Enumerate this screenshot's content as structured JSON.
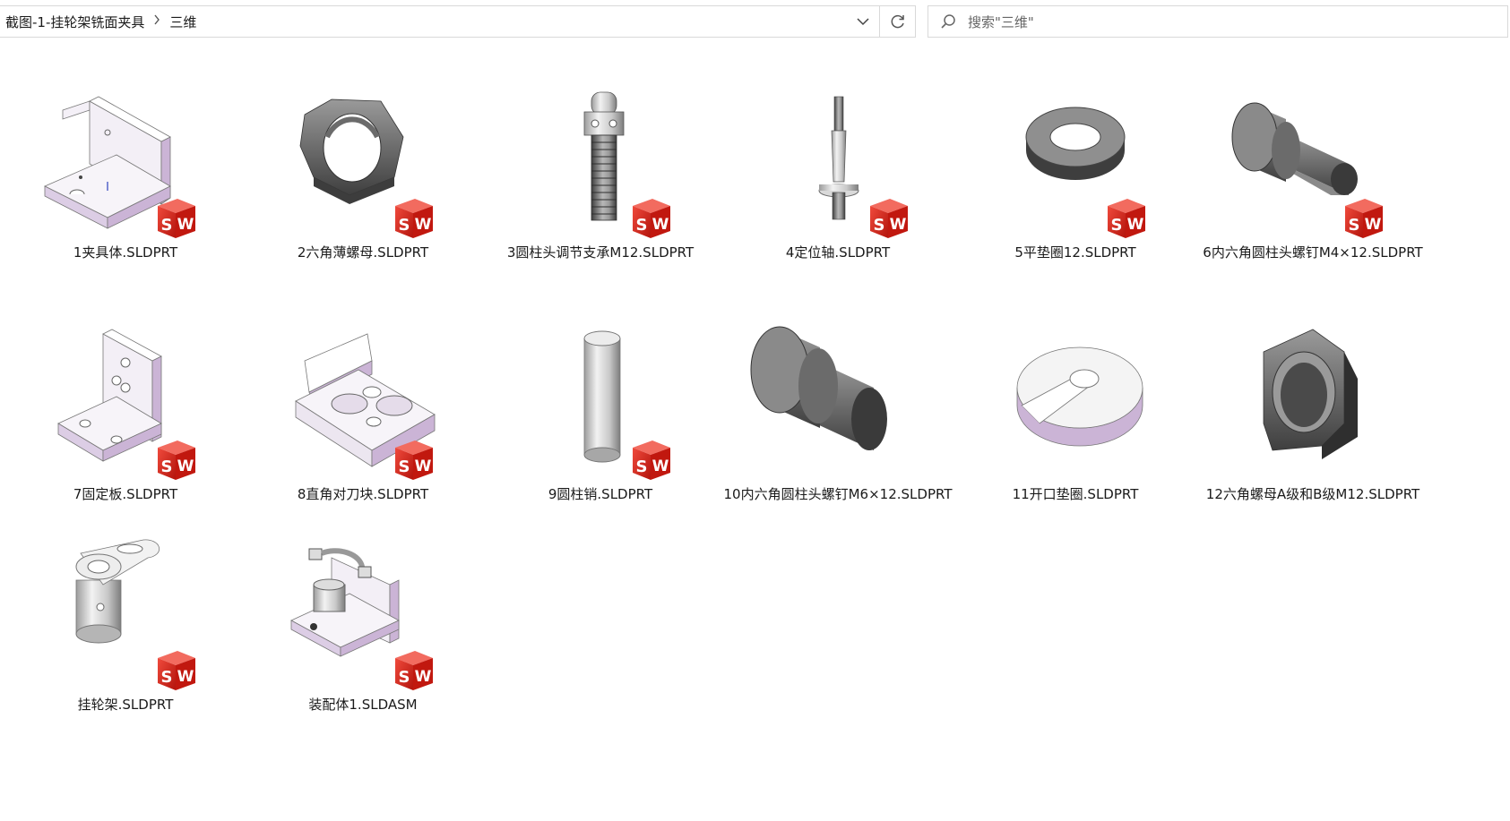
{
  "address_bar": {
    "breadcrumb": [
      "截图-1-挂轮架铣面夹具",
      "三维"
    ],
    "separator_icon": "chevron-right-icon",
    "dropdown_icon": "chevron-down-icon",
    "refresh_icon": "refresh-icon"
  },
  "search": {
    "placeholder": "搜索\"三维\"",
    "icon": "search-icon"
  },
  "files": [
    {
      "name": "1夹具体.SLDPRT",
      "thumb": "fixture-body",
      "badge": "solidworks-part-icon"
    },
    {
      "name": "2六角薄螺母.SLDPRT",
      "thumb": "thin-hex-nut",
      "badge": "solidworks-part-icon"
    },
    {
      "name": "3圆柱头调节支承M12.SLDPRT",
      "thumb": "adjustable-support",
      "badge": "solidworks-part-icon"
    },
    {
      "name": "4定位轴.SLDPRT",
      "thumb": "locating-shaft",
      "badge": "solidworks-part-icon"
    },
    {
      "name": "5平垫圈12.SLDPRT",
      "thumb": "flat-washer",
      "badge": "solidworks-part-icon"
    },
    {
      "name": "6内六角圆柱头螺钉M4×12.SLDPRT",
      "thumb": "socket-cap-screw-small",
      "badge": "solidworks-part-icon"
    },
    {
      "name": "7固定板.SLDPRT",
      "thumb": "fixed-plate",
      "badge": "solidworks-part-icon"
    },
    {
      "name": "8直角对刀块.SLDPRT",
      "thumb": "tool-setting-block",
      "badge": "solidworks-part-icon"
    },
    {
      "name": "9圆柱销.SLDPRT",
      "thumb": "cylindrical-pin",
      "badge": "solidworks-part-icon"
    },
    {
      "name": "10内六角圆柱头螺钉M6×12.SLDPRT",
      "thumb": "socket-cap-screw-large",
      "badge": ""
    },
    {
      "name": "11开口垫圈.SLDPRT",
      "thumb": "open-washer",
      "badge": ""
    },
    {
      "name": "12六角螺母A级和B级M12.SLDPRT",
      "thumb": "hex-nut",
      "badge": ""
    },
    {
      "name": "挂轮架.SLDPRT",
      "thumb": "gear-bracket",
      "badge": "solidworks-part-icon"
    },
    {
      "name": "装配体1.SLDASM",
      "thumb": "assembly",
      "badge": "solidworks-assembly-icon"
    }
  ],
  "colors": {
    "part_face": "#e6dcec",
    "part_shadow": "#cbb4d6",
    "metal_dark": "#4a4a4a",
    "badge_red": "#d9251c"
  }
}
